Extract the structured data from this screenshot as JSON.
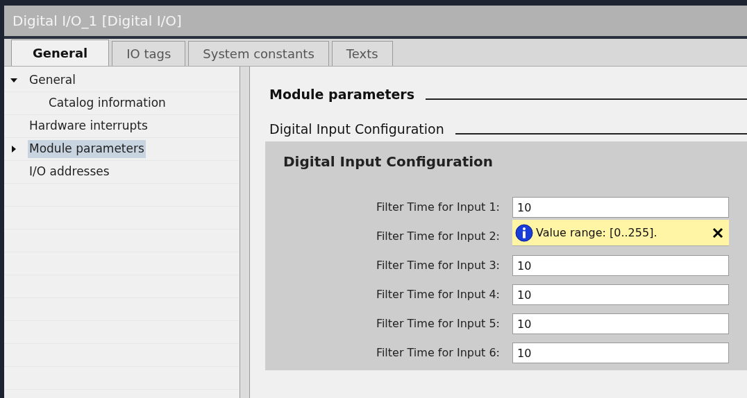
{
  "window": {
    "title": "Digital I/O_1 [Digital I/O]"
  },
  "tabs": [
    {
      "label": "General",
      "selected": true
    },
    {
      "label": "IO tags",
      "selected": false
    },
    {
      "label": "System constants",
      "selected": false
    },
    {
      "label": "Texts",
      "selected": false
    }
  ],
  "sidebar": {
    "items": [
      {
        "label": "General",
        "expanded": true,
        "selected": false,
        "children": [
          {
            "label": "Catalog information",
            "selected": false
          }
        ]
      },
      {
        "label": "Hardware interrupts",
        "selected": false
      },
      {
        "label": "Module parameters",
        "expanded": false,
        "selected": true
      },
      {
        "label": "I/O addresses",
        "selected": false
      }
    ]
  },
  "content": {
    "heading": "Module parameters",
    "subheading": "Digital Input Configuration",
    "section": {
      "title": "Digital Input Configuration",
      "fields": [
        {
          "label": "Filter Time for Input 1:",
          "value": "10"
        },
        {
          "label": "Filter Time for Input 2:",
          "tooltip": "Value range: [0..255]."
        },
        {
          "label": "Filter Time for Input 3:",
          "value": "10"
        },
        {
          "label": "Filter Time for Input 4:",
          "value": "10"
        },
        {
          "label": "Filter Time for Input 5:",
          "value": "10"
        },
        {
          "label": "Filter Time for Input 6:",
          "value": "10"
        }
      ]
    }
  }
}
